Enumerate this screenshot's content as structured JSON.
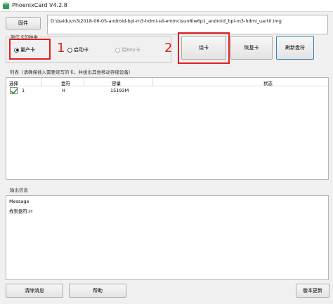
{
  "window": {
    "title": "PhoenixCard V4.2.8",
    "icon": "phoenixcard-app-icon"
  },
  "firmware": {
    "button_label": "固件",
    "path": "D:\\baidu\\m3\\2018-06-05-android-bpi-m3-hdmi-sd-emmc\\sun8iw6p1_android_bpi-m3-hdmi_uart0.img"
  },
  "card_mode": {
    "group_title": "制作卡的种类",
    "options": [
      {
        "label": "量产卡",
        "selected": true,
        "enabled": true
      },
      {
        "label": "启动卡",
        "selected": false,
        "enabled": true
      },
      {
        "label": "烧Key卡",
        "selected": false,
        "enabled": false
      }
    ]
  },
  "actions": {
    "burn": "烧卡",
    "restore": "恢复卡",
    "refresh": "刷新盘符"
  },
  "annotations": {
    "step1": "1",
    "step2": "2"
  },
  "list": {
    "label": "列表（请确保插入需要烧写的卡，并拔出其他移动存储设备）",
    "columns": [
      "选择",
      "盘符",
      "容量",
      "状态"
    ],
    "rows": [
      {
        "index": "1",
        "checked": true,
        "drive": "H",
        "capacity": "15193M",
        "status": ""
      }
    ]
  },
  "output": {
    "label": "输出信息",
    "lines": [
      "Message",
      "找到盘符:H"
    ]
  },
  "bottom": {
    "clear": "清除消息",
    "help": "帮助",
    "update": "版本更新"
  },
  "colors": {
    "annotation_red": "#e02020",
    "check_green": "#1a9a3a",
    "accent_blue": "#3c7fb1"
  }
}
